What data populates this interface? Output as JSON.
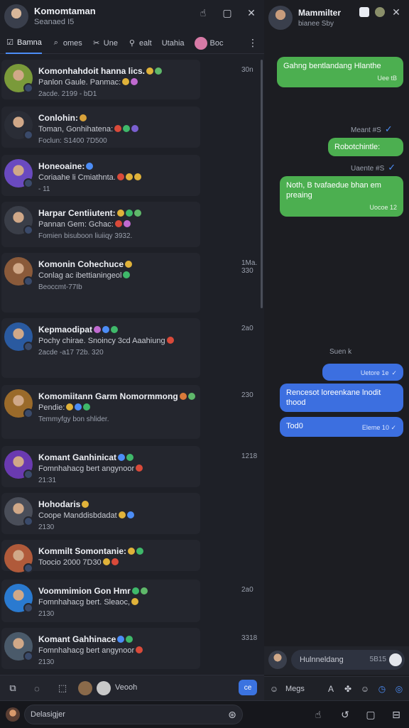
{
  "header": {
    "title": "Komomtaman",
    "subtitle": "Seanaed I5",
    "icons": [
      "touch-icon",
      "square-icon",
      "close-icon"
    ]
  },
  "tabs": [
    {
      "label": "Bamna",
      "icon": "checkbox-icon",
      "active": true
    },
    {
      "label": "omes",
      "icon": "search-icon",
      "active": false
    },
    {
      "label": "Une",
      "icon": "crossed-icon",
      "active": false
    },
    {
      "label": "ealt",
      "icon": "magnifier-icon",
      "active": false
    },
    {
      "label": "Utahia",
      "icon": "",
      "active": false
    },
    {
      "label": "Boc",
      "icon": "avatar-icon",
      "active": false
    }
  ],
  "conversations": [
    {
      "name": "Komonhahdoit hanna lics.",
      "line2": "Panlon Gaule. Panmac:",
      "line3": "2acde. 2199 - bD1",
      "time": "30n",
      "accent": "#7a9a3a",
      "emojis": [
        "#e0b23a",
        "#5fb86a"
      ],
      "emojis2": [
        "#e0b23a",
        "#c06ad0"
      ]
    },
    {
      "name": "Conlohin:",
      "line2": "Toman, Gonhihatena:",
      "line3": "Foclun: S1400 7D500",
      "time": "",
      "accent": "#2a2d36",
      "emojis": [
        "#d9a23a"
      ],
      "emojis2": [
        "#d94a3a",
        "#3fb86a",
        "#7a5fd0"
      ]
    },
    {
      "name": "Honeoaine:",
      "line2": "Coriaahe li Cmiathnta.",
      "line3": "- 11",
      "time": "",
      "accent": "#6a4ac0",
      "emojis": [
        "#4c8df6"
      ],
      "emojis2": [
        "#d94a3a",
        "#e0b23a",
        "#e0b23a"
      ]
    },
    {
      "name": "Harpar Centiiutent:",
      "line2": "Pannan Gem: Gchac:",
      "line3": "Fomien bisuboon liuiiqy 3932.",
      "time": "",
      "accent": "#3a3e48",
      "emojis": [
        "#e0b23a",
        "#3fb86a",
        "#5fb86a"
      ],
      "emojis2": [
        "#d94a3a",
        "#c06ad0"
      ]
    },
    {
      "name": "Komonin Cohechuce",
      "line2": "Conlag ac ibettianingeol",
      "line3": "Beoccmt-77Ib",
      "time": "1Ma. 330",
      "accent": "#8a5a3a",
      "emojis": [
        "#e0b23a"
      ],
      "emojis2": [
        "#3fb86a"
      ]
    },
    {
      "name": "Kepmaodipat",
      "line2": "Pochy chirae. Snoincy 3cd Aaahiung",
      "line3": "2acde -a17 72b. 320",
      "time": "2a0",
      "accent": "#2a5aa0",
      "emojis": [
        "#c06ad0",
        "#4c8df6",
        "#3fb86a"
      ],
      "emojis2": [
        "#d94a3a"
      ]
    },
    {
      "name": "Komomiitann Garm Nomormmong",
      "line2": "Pendie:",
      "line3": "Temmyfgy bon shlider.",
      "time": "230",
      "accent": "#9a6a2a",
      "emojis": [
        "#d97a3a",
        "#5fb86a"
      ],
      "emojis2": [
        "#e0b23a",
        "#4c8df6",
        "#3fb86a"
      ]
    },
    {
      "name": "Komant Ganhinicat",
      "line2": "Fomnhahacg bert angynoor",
      "line3": "21:31",
      "time": "1218",
      "accent": "#6a3ab0",
      "emojis": [
        "#4c8df6",
        "#3fb86a"
      ],
      "emojis2": [
        "#d94a3a"
      ]
    },
    {
      "name": "Hohodaris",
      "line2": "Coope Manddisbdadat",
      "line3": "2130",
      "time": "",
      "accent": "#4a4e59",
      "emojis": [
        "#e0b23a"
      ],
      "emojis2": [
        "#e0b23a",
        "#4c8df6"
      ]
    },
    {
      "name": "Kommilt Somontanie:",
      "line2": "Toocio 2000 7D30",
      "line3": "",
      "time": "",
      "accent": "#b05a3a",
      "emojis": [
        "#e0b23a",
        "#3fb86a"
      ],
      "emojis2": [
        "#e0b23a",
        "#d94a3a"
      ]
    },
    {
      "name": "Voommimion Gon Hmr",
      "line2": "Fomnhahacg bert. Sleaoc,",
      "line3": "2130",
      "time": "2a0",
      "accent": "#2a7ad0",
      "emojis": [
        "#3fb86a",
        "#5fb86a"
      ],
      "emojis2": [
        "#e0b23a"
      ]
    },
    {
      "name": "Komant Gahhinace",
      "line2": "Fomnhahacg bert angynoor",
      "line3": "2130",
      "time": "3318",
      "accent": "#4a5a6a",
      "emojis": [
        "#4c8df6",
        "#3fb86a"
      ],
      "emojis2": [
        "#d94a3a"
      ]
    }
  ],
  "composer": {
    "label": "Veooh",
    "send_label": "ce",
    "icons": [
      "pin-icon",
      "chat-icon",
      "box-icon"
    ]
  },
  "chat": {
    "title": "Mammilter",
    "subtitle": "bianee Sby",
    "messages": [
      {
        "kind": "out-green",
        "text": "Gahng bentlandang Hlanthe",
        "meta": "Uee tB"
      },
      {
        "kind": "status",
        "text": "Meant #S"
      },
      {
        "kind": "out-green",
        "text": "Robotchintle:",
        "meta": ""
      },
      {
        "kind": "status",
        "text": "Uaente #S"
      },
      {
        "kind": "out-green",
        "text": "Noth, B tvafaedue bhan em preaing",
        "meta": "Uocoe 12"
      },
      {
        "kind": "status",
        "text": "Suen k"
      },
      {
        "kind": "out-blue",
        "text": "",
        "meta": "Uetore 1e"
      },
      {
        "kind": "out-blue",
        "text": "Rencesot loreenkane lnodit thood",
        "meta": ""
      },
      {
        "kind": "out-blue",
        "text": "Tod0",
        "meta": "Eleme 10"
      }
    ],
    "input_placeholder": "Hulnneldang",
    "input_count": "5B15",
    "toolbar_label": "Megs"
  },
  "bottom": {
    "placeholder": "Delasigjer",
    "icons": [
      "hand-icon",
      "share-icon",
      "frame-icon",
      "bookmark-icon"
    ]
  },
  "colors": {
    "accent_blue": "#3c6fe0",
    "bubble_green": "#4caf50",
    "bg": "#1a1c23"
  }
}
